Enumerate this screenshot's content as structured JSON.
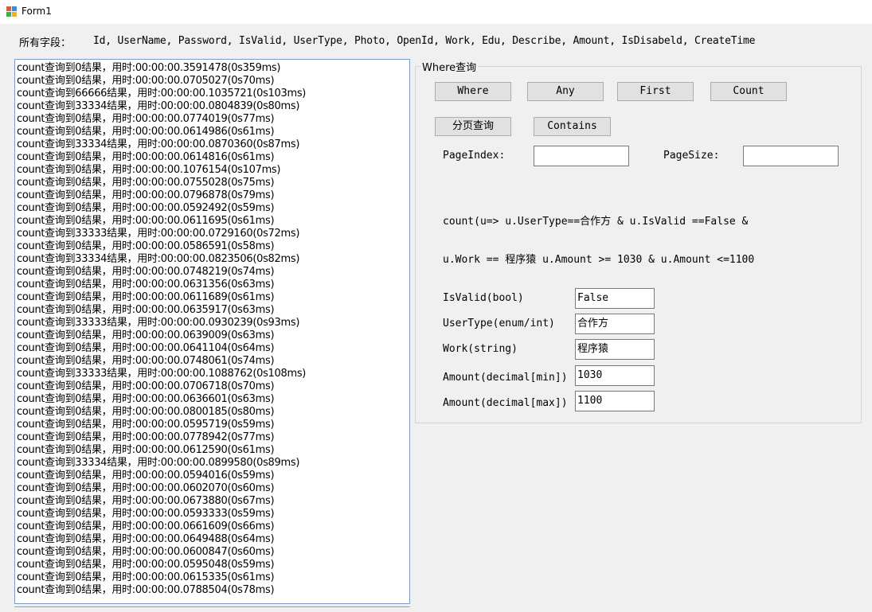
{
  "window": {
    "title": "Form1"
  },
  "fields": {
    "label": "所有字段：",
    "list": "Id, UserName, Password, IsValid, UserType, Photo, OpenId, Work, Edu, Describe, Amount, IsDisabeld, CreateTime"
  },
  "log": [
    "count查询到0结果，用时:00:00:00.3591478(0s359ms)",
    "count查询到0结果，用时:00:00:00.0705027(0s70ms)",
    "count查询到66666结果，用时:00:00:00.1035721(0s103ms)",
    "count查询到33334结果，用时:00:00:00.0804839(0s80ms)",
    "count查询到0结果，用时:00:00:00.0774019(0s77ms)",
    "count查询到0结果，用时:00:00:00.0614986(0s61ms)",
    "count查询到33334结果，用时:00:00:00.0870360(0s87ms)",
    "count查询到0结果，用时:00:00:00.0614816(0s61ms)",
    "count查询到0结果，用时:00:00:00.1076154(0s107ms)",
    "count查询到0结果，用时:00:00:00.0755028(0s75ms)",
    "count查询到0结果，用时:00:00:00.0796878(0s79ms)",
    "count查询到0结果，用时:00:00:00.0592492(0s59ms)",
    "count查询到0结果，用时:00:00:00.0611695(0s61ms)",
    "count查询到33333结果，用时:00:00:00.0729160(0s72ms)",
    "count查询到0结果，用时:00:00:00.0586591(0s58ms)",
    "count查询到33334结果，用时:00:00:00.0823506(0s82ms)",
    "count查询到0结果，用时:00:00:00.0748219(0s74ms)",
    "count查询到0结果，用时:00:00:00.0631356(0s63ms)",
    "count查询到0结果，用时:00:00:00.0611689(0s61ms)",
    "count查询到0结果，用时:00:00:00.0635917(0s63ms)",
    "count查询到33333结果，用时:00:00:00.0930239(0s93ms)",
    "count查询到0结果，用时:00:00:00.0639009(0s63ms)",
    "count查询到0结果，用时:00:00:00.0641104(0s64ms)",
    "count查询到0结果，用时:00:00:00.0748061(0s74ms)",
    "count查询到33333结果，用时:00:00:00.1088762(0s108ms)",
    "count查询到0结果，用时:00:00:00.0706718(0s70ms)",
    "count查询到0结果，用时:00:00:00.0636601(0s63ms)",
    "count查询到0结果，用时:00:00:00.0800185(0s80ms)",
    "count查询到0结果，用时:00:00:00.0595719(0s59ms)",
    "count查询到0结果，用时:00:00:00.0778942(0s77ms)",
    "count查询到0结果，用时:00:00:00.0612590(0s61ms)",
    "count查询到33334结果，用时:00:00:00.0899580(0s89ms)",
    "count查询到0结果，用时:00:00:00.0594016(0s59ms)",
    "count查询到0结果，用时:00:00:00.0602070(0s60ms)",
    "count查询到0结果，用时:00:00:00.0673880(0s67ms)",
    "count查询到0结果，用时:00:00:00.0593333(0s59ms)",
    "count查询到0结果，用时:00:00:00.0661609(0s66ms)",
    "count查询到0结果，用时:00:00:00.0649488(0s64ms)",
    "count查询到0结果，用时:00:00:00.0600847(0s60ms)",
    "count查询到0结果，用时:00:00:00.0595048(0s59ms)",
    "count查询到0结果，用时:00:00:00.0615335(0s61ms)",
    "count查询到0结果，用时:00:00:00.0788504(0s78ms)"
  ],
  "query_group": {
    "legend": "Where查询",
    "buttons": {
      "where": "Where",
      "any": "Any",
      "first": "First",
      "count": "Count",
      "paging": "分页查询",
      "contains": "Contains"
    },
    "page_index_label": "PageIndex:",
    "page_index_value": "",
    "page_size_label": "PageSize:",
    "page_size_value": "",
    "expression_line1": "count(u=> u.UserType==合作方 & u.IsValid ==False &",
    "expression_line2": "u.Work == 程序猿 u.Amount >= 1030 & u.Amount <=1100",
    "params": {
      "is_valid_label": "IsValid(bool)",
      "is_valid_value": "False",
      "user_type_label": "UserType(enum/int)",
      "user_type_value": "合作方",
      "work_label": "Work(string)",
      "work_value": "程序猿",
      "amount_min_label": "Amount(decimal[min])",
      "amount_min_value": "1030",
      "amount_max_label": "Amount(decimal[max])",
      "amount_max_value": "1100"
    }
  }
}
